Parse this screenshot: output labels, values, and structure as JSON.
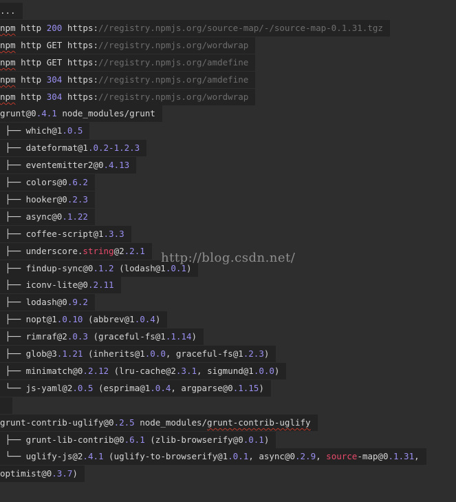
{
  "terminal": {
    "lines": [
      [
        {
          "t": "..."
        }
      ],
      [
        {
          "t": "npm",
          "c": "sq"
        },
        {
          "t": " http "
        },
        {
          "t": "200",
          "c": "ver"
        },
        {
          "t": " https:"
        },
        {
          "t": "//registry.npmjs.org/source-map/-/source-map-0.1.31.tgz",
          "c": "url"
        }
      ],
      [
        {
          "t": "npm",
          "c": "sq"
        },
        {
          "t": " http GET https:"
        },
        {
          "t": "//registry.npmjs.org/wordwrap",
          "c": "url"
        }
      ],
      [
        {
          "t": "npm",
          "c": "sq"
        },
        {
          "t": " http GET https:"
        },
        {
          "t": "//registry.npmjs.org/amdefine",
          "c": "url"
        }
      ],
      [
        {
          "t": "npm",
          "c": "sq"
        },
        {
          "t": " http "
        },
        {
          "t": "304",
          "c": "ver"
        },
        {
          "t": " https:"
        },
        {
          "t": "//registry.npmjs.org/amdefine",
          "c": "url"
        }
      ],
      [
        {
          "t": "npm",
          "c": "sq"
        },
        {
          "t": " http "
        },
        {
          "t": "304",
          "c": "ver"
        },
        {
          "t": " https:"
        },
        {
          "t": "//registry.npmjs.org/wordwrap",
          "c": "url"
        }
      ],
      [
        {
          "t": "grunt@0"
        },
        {
          "t": ".4.1",
          "c": "ver"
        },
        {
          "t": " node_modules/grunt"
        }
      ],
      [
        {
          "t": " ├── which@1"
        },
        {
          "t": ".0.5",
          "c": "ver"
        }
      ],
      [
        {
          "t": " ├── dateformat@1"
        },
        {
          "t": ".0.2-1.2.3",
          "c": "ver"
        }
      ],
      [
        {
          "t": " ├── eventemitter2@0"
        },
        {
          "t": ".4.13",
          "c": "ver"
        }
      ],
      [
        {
          "t": " ├── colors@0"
        },
        {
          "t": ".6.2",
          "c": "ver"
        }
      ],
      [
        {
          "t": " ├── hooker@0"
        },
        {
          "t": ".2.3",
          "c": "ver"
        }
      ],
      [
        {
          "t": " ├── async@0"
        },
        {
          "t": ".1.22",
          "c": "ver"
        }
      ],
      [
        {
          "t": " ├── coffee-script@1"
        },
        {
          "t": ".3.3",
          "c": "ver"
        }
      ],
      [
        {
          "t": " ├── underscore."
        },
        {
          "t": "string",
          "c": "hl"
        },
        {
          "t": "@2"
        },
        {
          "t": ".2.1",
          "c": "ver"
        }
      ],
      [
        {
          "t": " ├── findup-sync@0"
        },
        {
          "t": ".1.2",
          "c": "ver"
        },
        {
          "t": " (lodash@1"
        },
        {
          "t": ".0.1",
          "c": "ver"
        },
        {
          "t": ")"
        }
      ],
      [
        {
          "t": " ├── iconv-lite@0"
        },
        {
          "t": ".2.11",
          "c": "ver"
        }
      ],
      [
        {
          "t": " ├── lodash@0"
        },
        {
          "t": ".9.2",
          "c": "ver"
        }
      ],
      [
        {
          "t": " ├── nopt@1"
        },
        {
          "t": ".0.10",
          "c": "ver"
        },
        {
          "t": " (abbrev@1"
        },
        {
          "t": ".0.4",
          "c": "ver"
        },
        {
          "t": ")"
        }
      ],
      [
        {
          "t": " ├── rimraf@2"
        },
        {
          "t": ".0.3",
          "c": "ver"
        },
        {
          "t": " (graceful-fs@1"
        },
        {
          "t": ".1.14",
          "c": "ver"
        },
        {
          "t": ")"
        }
      ],
      [
        {
          "t": " ├── glob@3"
        },
        {
          "t": ".1.21",
          "c": "ver"
        },
        {
          "t": " (inherits@1"
        },
        {
          "t": ".0.0",
          "c": "ver"
        },
        {
          "t": ", graceful-fs@1"
        },
        {
          "t": ".2.3",
          "c": "ver"
        },
        {
          "t": ")"
        }
      ],
      [
        {
          "t": " ├── minimatch@0"
        },
        {
          "t": ".2.12",
          "c": "ver"
        },
        {
          "t": " (lru-cache@2"
        },
        {
          "t": ".3.1",
          "c": "ver"
        },
        {
          "t": ", sigmund@1"
        },
        {
          "t": ".0.0",
          "c": "ver"
        },
        {
          "t": ")"
        }
      ],
      [
        {
          "t": " └── js-yaml@2"
        },
        {
          "t": ".0.5",
          "c": "ver"
        },
        {
          "t": " (esprima@1"
        },
        {
          "t": ".0.4",
          "c": "ver"
        },
        {
          "t": ", argparse@0"
        },
        {
          "t": ".1.15",
          "c": "ver"
        },
        {
          "t": ")"
        }
      ],
      [
        {
          "t": " "
        }
      ],
      [
        {
          "t": "grunt-contrib-uglify@0"
        },
        {
          "t": ".2.5",
          "c": "ver"
        },
        {
          "t": " node_modules/"
        },
        {
          "t": "grunt-contrib-uglify",
          "c": "sq"
        }
      ],
      [
        {
          "t": " ├── grunt-lib-contrib@0"
        },
        {
          "t": ".6.1",
          "c": "ver"
        },
        {
          "t": " (zlib-browserify@0"
        },
        {
          "t": ".0.1",
          "c": "ver"
        },
        {
          "t": ")"
        }
      ],
      [
        {
          "t": " └── uglify-js@2"
        },
        {
          "t": ".4.1",
          "c": "ver"
        },
        {
          "t": " (uglify-to-browserify@1"
        },
        {
          "t": ".0.1",
          "c": "ver"
        },
        {
          "t": ", async@0"
        },
        {
          "t": ".2.9",
          "c": "ver"
        },
        {
          "t": ", "
        },
        {
          "t": "source",
          "c": "hl"
        },
        {
          "t": "-map@0"
        },
        {
          "t": ".1.31",
          "c": "ver"
        },
        {
          "t": ","
        }
      ],
      [
        {
          "t": "optimist@0"
        },
        {
          "t": ".3.7",
          "c": "ver"
        },
        {
          "t": ")"
        }
      ]
    ]
  },
  "watermark": "http://blog.csdn.net/"
}
